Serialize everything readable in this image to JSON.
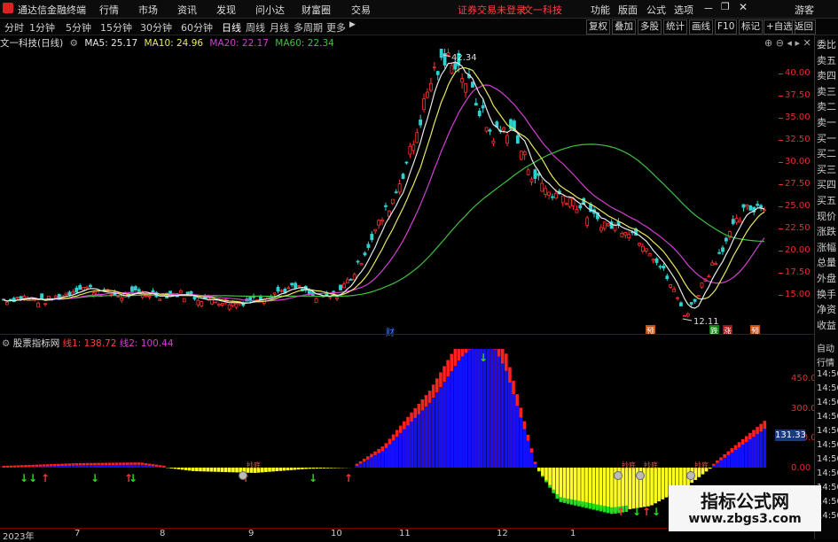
{
  "app": {
    "title": "通达信金融终端",
    "guest": "游客",
    "status": "证券交易未登录",
    "stock_short": "文一科技"
  },
  "top_menu": [
    "行情",
    "市场",
    "资讯",
    "发现",
    "问小达",
    "财富圈",
    "交易"
  ],
  "top_right_menu": [
    "功能",
    "版面",
    "公式",
    "选项"
  ],
  "timeframes": [
    "分时",
    "1分钟",
    "5分钟",
    "15分钟",
    "30分钟",
    "60分钟",
    "日线",
    "周线",
    "月线",
    "多周期",
    "更多"
  ],
  "active_timeframe": "日线",
  "toolbar_right": [
    "复权",
    "叠加",
    "多股",
    "统计",
    "画线",
    "F10",
    "标记",
    "+自选",
    "返回"
  ],
  "main_chart": {
    "title": "文一科技(日线)",
    "indicators": [
      {
        "label": "MA5: 25.17",
        "color": "#e8e8e8"
      },
      {
        "label": "MA10: 24.96",
        "color": "#e8e860"
      },
      {
        "label": "MA20: 22.17",
        "color": "#d040d0"
      },
      {
        "label": "MA60: 22.34",
        "color": "#40c040"
      }
    ],
    "y_ticks": [
      "40.00",
      "37.50",
      "35.00",
      "32.50",
      "30.00",
      "27.50",
      "25.00",
      "22.50",
      "20.00",
      "17.50",
      "15.00"
    ],
    "high_label": "42.34",
    "low_label": "12.11",
    "markers": [
      {
        "text": "财",
        "color": "#4080ff"
      },
      {
        "text": "预",
        "color": "#e06020"
      },
      {
        "text": "跌",
        "color": "#20c020"
      },
      {
        "text": "涨",
        "color": "#e03030"
      },
      {
        "text": "预",
        "color": "#e06020"
      }
    ],
    "colors": {
      "up": "#ff3030",
      "down": "#30d0d0",
      "ma5": "#e8e8e8",
      "ma10": "#e8e860",
      "ma20": "#d040d0",
      "ma60": "#40c040"
    }
  },
  "sub_chart": {
    "title": "股票指标网",
    "line1": "线1: 138.72",
    "line2": "线2: 100.44",
    "y_ticks": [
      "450.00",
      "300.00",
      "150.00",
      "0.00"
    ],
    "current_value": "131.33",
    "signal_label": "抄底",
    "colors": {
      "red": "#ff2020",
      "blue": "#1010ff",
      "yellow": "#ffff20",
      "green": "#20e020"
    }
  },
  "right_panel": {
    "top_items": [
      "委比",
      "卖五",
      "卖四",
      "卖三",
      "卖二",
      "卖一",
      "买一",
      "买二",
      "买三",
      "买四",
      "买五",
      "现价",
      "涨跌",
      "涨幅",
      "总量",
      "外盘",
      "换手",
      "净资",
      "收益"
    ],
    "bottom_items": [
      "自动",
      "行情",
      "14:50",
      "14:50",
      "14:50",
      "14:50",
      "14:50",
      "14:50",
      "14:50",
      "14:50",
      "14:50",
      "14:50",
      "14:50"
    ]
  },
  "dates": [
    "2023年",
    "7",
    "8",
    "9",
    "10",
    "11",
    "12",
    "1"
  ],
  "watermark": {
    "line1": "指标公式网",
    "line2": "www.zbgs3.com"
  },
  "chart_data": {
    "type": "candlestick",
    "title": "文一科技(日线)",
    "ylim": [
      12,
      43
    ],
    "y_ticks": [
      15,
      17.5,
      20,
      22.5,
      25,
      27.5,
      30,
      32.5,
      35,
      37.5,
      40
    ],
    "x_labels": [
      "2023年",
      "7",
      "8",
      "9",
      "10",
      "11",
      "12",
      "1"
    ],
    "close_series": [
      {
        "period": "2023年",
        "values": [
          14.4,
          14.7,
          14.2,
          14.9
        ]
      },
      {
        "period": "7",
        "values": [
          15.9,
          15.3,
          14.8,
          15.2,
          14.9
        ]
      },
      {
        "period": "8",
        "values": [
          15.1,
          14.6,
          14.3,
          14.0
        ]
      },
      {
        "period": "9",
        "values": [
          14.6,
          15.3,
          15.8,
          14.6
        ]
      },
      {
        "period": "10",
        "values": [
          14.8,
          17.5,
          22.0,
          26.0
        ]
      },
      {
        "period": "11",
        "values": [
          32.0,
          40.0,
          42.0,
          38.0,
          33.0
        ]
      },
      {
        "period": "12",
        "values": [
          34.0,
          29.0,
          26.5,
          26.0
        ]
      },
      {
        "period": "1",
        "values": [
          24.0,
          22.8,
          22.5,
          20.5,
          17.0,
          12.5,
          17.0,
          21.0,
          24.5,
          25.2
        ]
      }
    ],
    "high": 42.34,
    "low": 12.11,
    "series": [
      {
        "name": "MA5",
        "last": 25.17
      },
      {
        "name": "MA10",
        "last": 24.96
      },
      {
        "name": "MA20",
        "last": 22.17
      },
      {
        "name": "MA60",
        "last": 22.34
      }
    ],
    "indicator": {
      "name": "股票指标网",
      "line1": 138.72,
      "line2": 100.44,
      "current": 131.33,
      "ylim": [
        0,
        480
      ]
    }
  }
}
